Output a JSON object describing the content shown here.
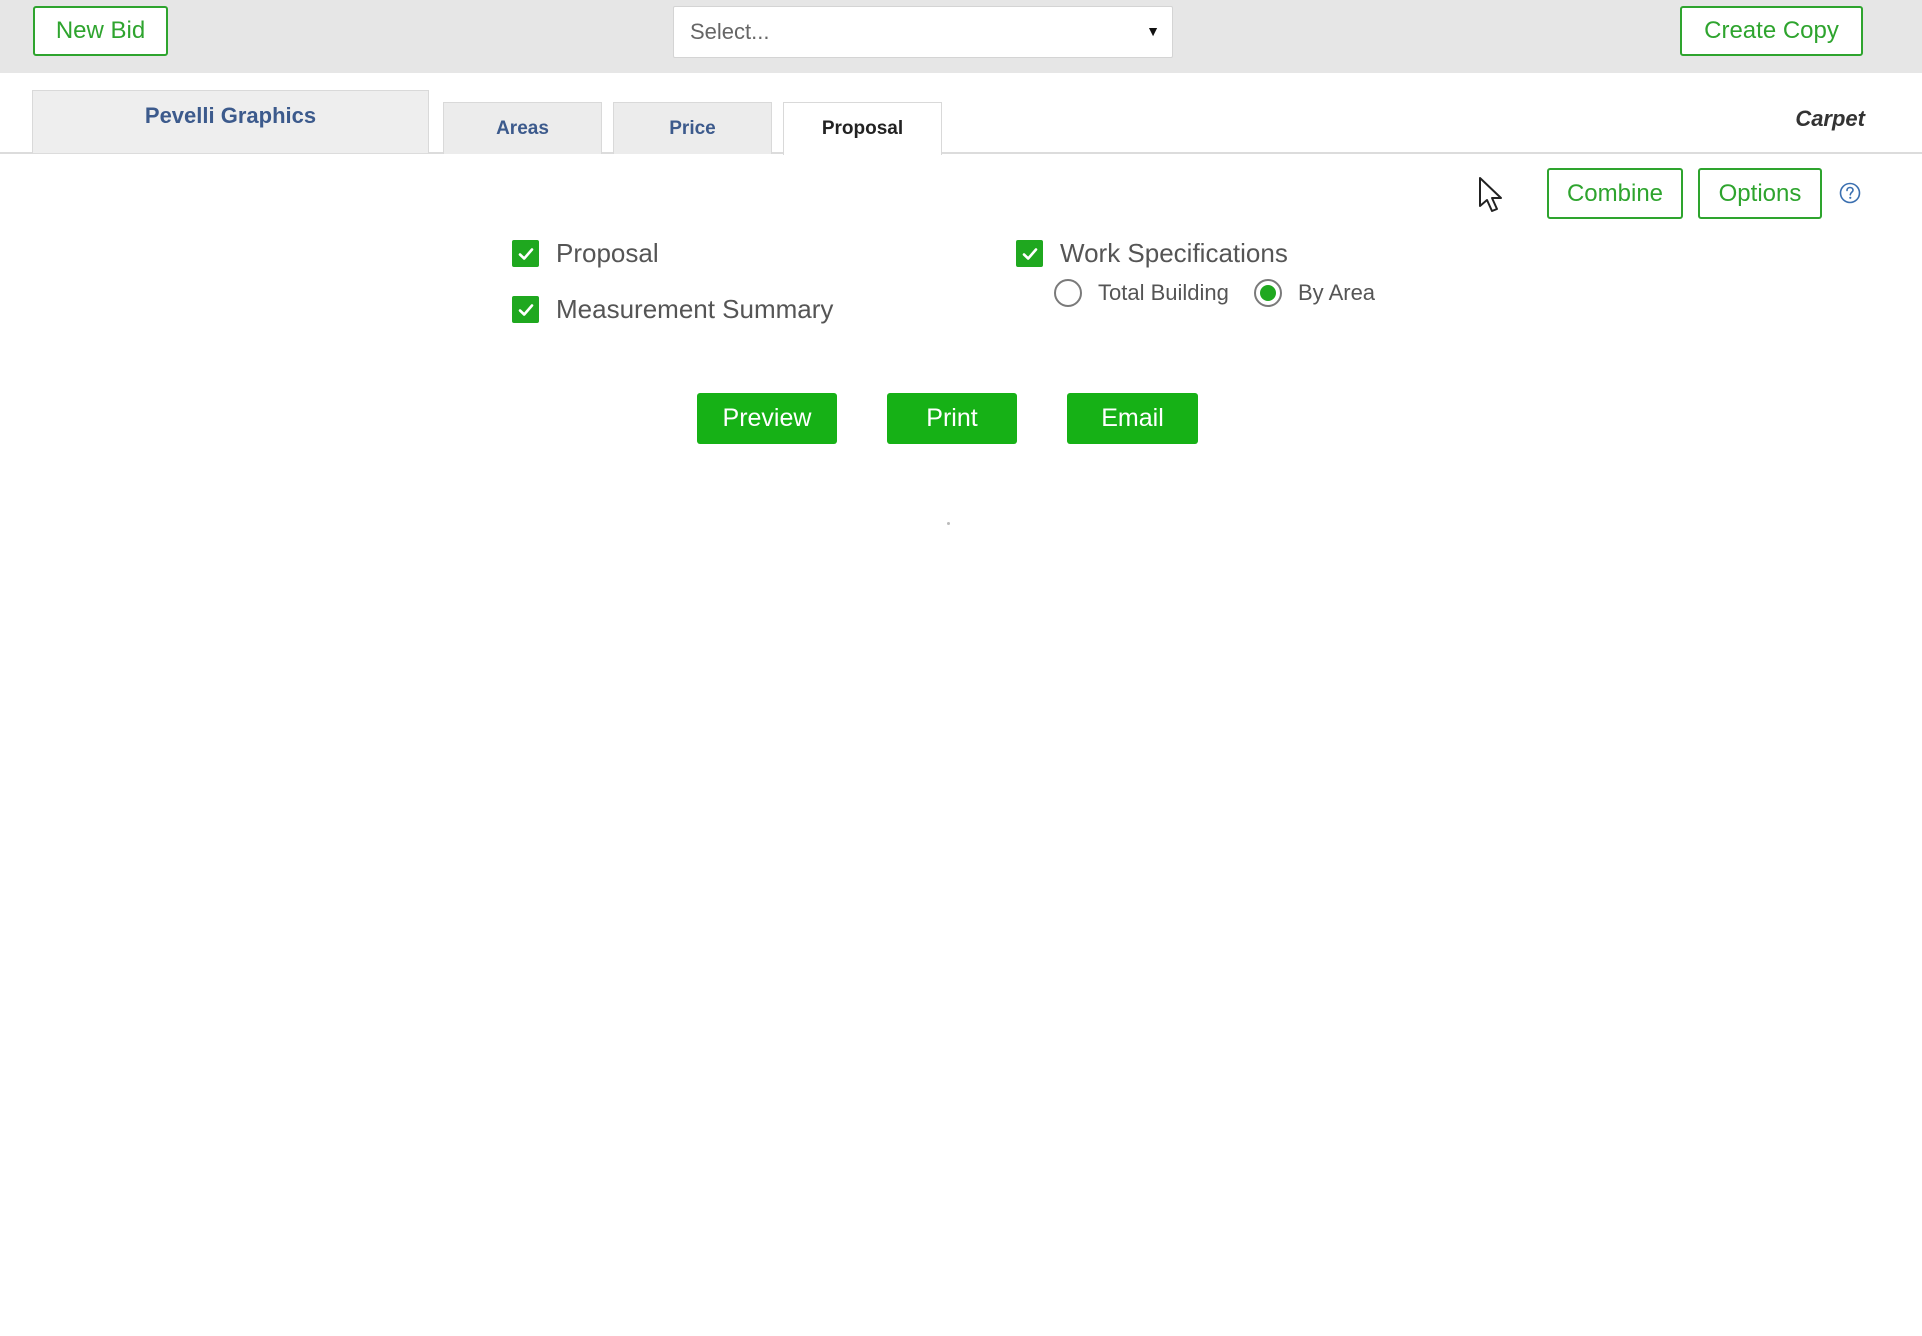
{
  "toolbar": {
    "new_bid_label": "New Bid",
    "select_placeholder": "Select...",
    "create_copy_label": "Create Copy"
  },
  "tabs": {
    "customer_name": "Pevelli Graphics",
    "items": [
      {
        "label": "Areas",
        "active": false
      },
      {
        "label": "Price",
        "active": false
      },
      {
        "label": "Proposal",
        "active": true
      }
    ],
    "product_type": "Carpet"
  },
  "proposal_options": {
    "combine_label": "Combine",
    "options_label": "Options",
    "help_icon": "question-circle-icon",
    "checkboxes": [
      {
        "label": "Proposal",
        "checked": true
      },
      {
        "label": "Measurement Summary",
        "checked": true
      },
      {
        "label": "Work Specifications",
        "checked": true
      }
    ],
    "work_spec_mode": {
      "options": [
        "Total Building",
        "By Area"
      ],
      "selected": "By Area"
    }
  },
  "actions": {
    "preview_label": "Preview",
    "print_label": "Print",
    "email_label": "Email"
  },
  "colors": {
    "accent_green": "#16b116",
    "outline_green": "#2ea42e",
    "tab_text": "#3c5a8c",
    "toolbar_bg": "#e6e6e6"
  }
}
